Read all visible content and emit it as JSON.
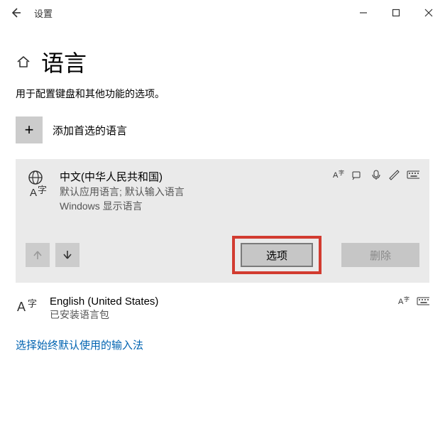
{
  "window": {
    "title": "设置"
  },
  "page": {
    "heading": "语言",
    "description": "用于配置键盘和其他功能的选项。"
  },
  "add": {
    "label": "添加首选的语言",
    "plus": "+"
  },
  "lang1": {
    "name": "中文(中华人民共和国)",
    "subtitle1": "默认应用语言; 默认输入语言",
    "subtitle2": "Windows 显示语言"
  },
  "actions": {
    "options": "选项",
    "delete": "删除"
  },
  "lang2": {
    "name": "English (United States)",
    "subtitle": "已安装语言包"
  },
  "link": "选择始终默认使用的输入法"
}
